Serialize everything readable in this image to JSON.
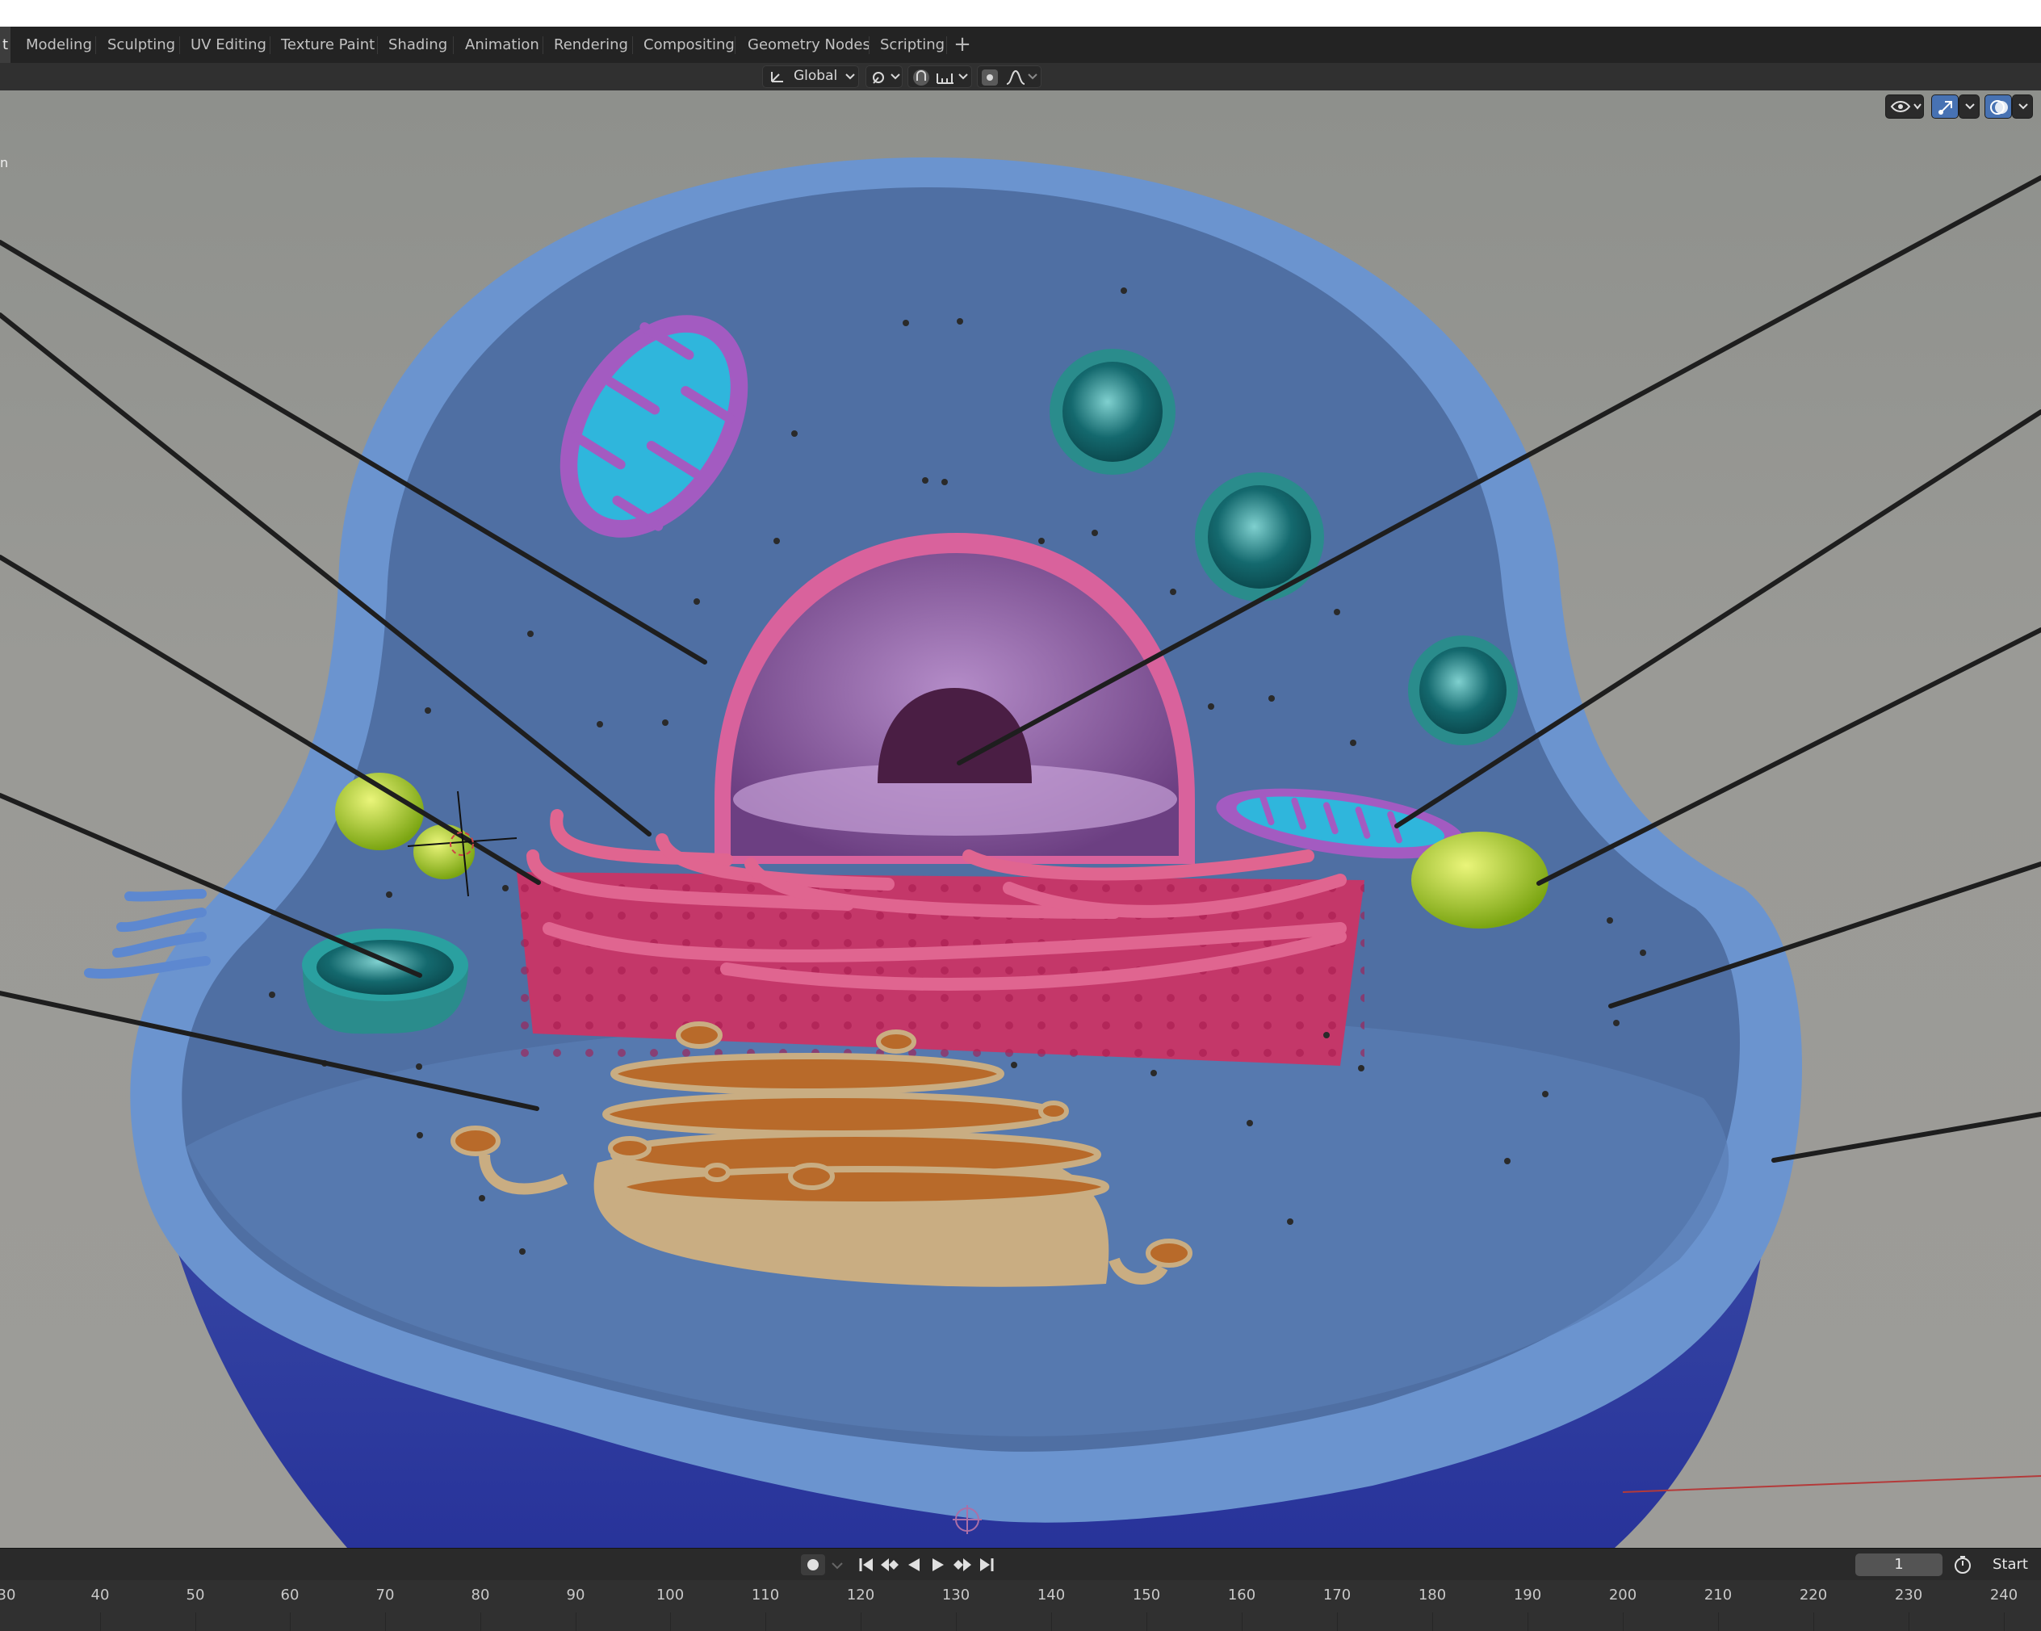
{
  "workspace_tabs": [
    {
      "label": "t"
    },
    {
      "label": "Modeling"
    },
    {
      "label": "Sculpting"
    },
    {
      "label": "UV Editing"
    },
    {
      "label": "Texture Paint"
    },
    {
      "label": "Shading"
    },
    {
      "label": "Animation"
    },
    {
      "label": "Rendering"
    },
    {
      "label": "Compositing"
    },
    {
      "label": "Geometry Nodes"
    },
    {
      "label": "Scripting"
    }
  ],
  "add_tab": "+",
  "toolbar": {
    "transform_orientation": "Global",
    "icons": [
      "orientation-icon",
      "chevron-down-icon",
      "pivot-icon",
      "snap-icon",
      "snap-increment-icon",
      "proportional-edit-icon",
      "falloff-icon"
    ]
  },
  "viewport": {
    "corner_text": "n",
    "gizmo_icons": [
      "eye-icon",
      "gizmo-icon",
      "overlay-icon"
    ]
  },
  "playback": {
    "current_frame": "1",
    "start_label": "Start",
    "controls": [
      "record-icon",
      "jump-start-icon",
      "prev-keyframe-icon",
      "play-reverse-icon",
      "play-icon",
      "next-keyframe-icon",
      "jump-end-icon",
      "stopwatch-icon"
    ]
  },
  "timeline_ticks": [
    "30",
    "40",
    "50",
    "60",
    "70",
    "80",
    "90",
    "100",
    "110",
    "120",
    "130",
    "140",
    "150",
    "160",
    "170",
    "180",
    "190",
    "200",
    "210",
    "220",
    "230",
    "240"
  ],
  "colors": {
    "accent": "#4772b3",
    "cell_wall": "#5e86c4",
    "cytoplasm": "#4d6e9f",
    "nucleus": "#d9629c",
    "er": "#c43769",
    "golgi": "#c9ad82",
    "mitochondria": "#a35bc1",
    "vacuole": "#2a8c8c",
    "lysosome": "#9acb2b"
  }
}
